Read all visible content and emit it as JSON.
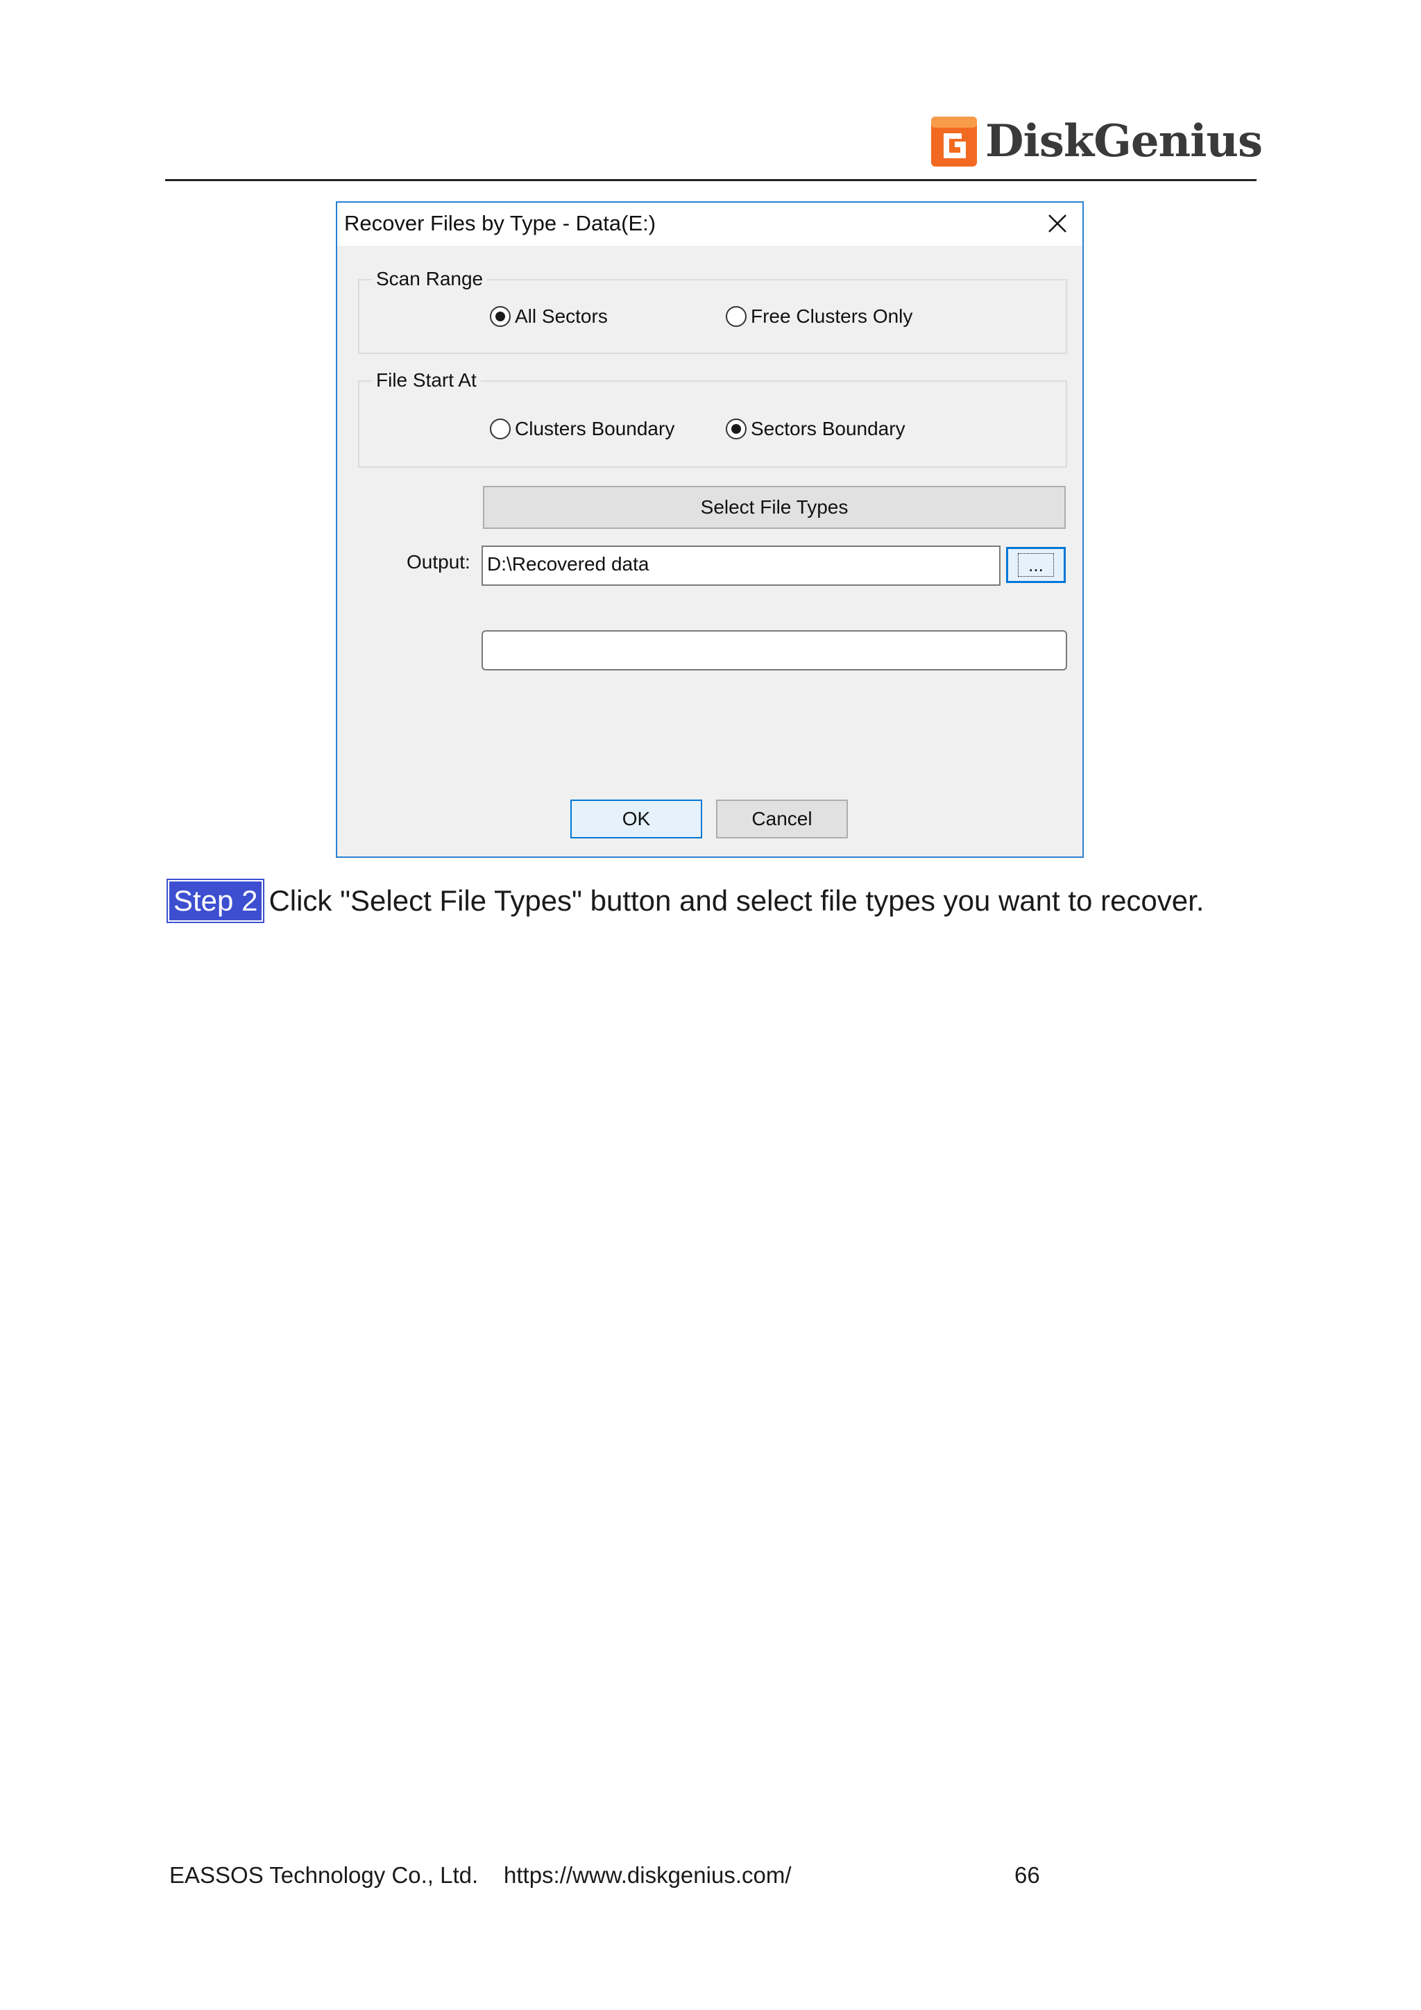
{
  "header": {
    "logo_text": "DiskGenius",
    "brand_color": "#f26a21"
  },
  "dialog": {
    "title": "Recover Files by Type - Data(E:)",
    "scan_range": {
      "label": "Scan Range",
      "options": [
        {
          "label": "All Sectors",
          "selected": true
        },
        {
          "label": "Free Clusters Only",
          "selected": false
        }
      ]
    },
    "file_start": {
      "label": "File Start At",
      "options": [
        {
          "label": "Clusters Boundary",
          "selected": false
        },
        {
          "label": "Sectors Boundary",
          "selected": true
        }
      ]
    },
    "select_types_label": "Select File Types",
    "output_label": "Output:",
    "output_value": "D:\\Recovered data",
    "browse_label": "...",
    "ok_label": "OK",
    "cancel_label": "Cancel"
  },
  "instruction": {
    "step_tag": "Step 2",
    "text": "Click \"Select File Types\" button and select file types you want to recover."
  },
  "footer": {
    "company": "EASSOS Technology Co., Ltd.",
    "url": "https://www.diskgenius.com/",
    "page_number": "66"
  }
}
